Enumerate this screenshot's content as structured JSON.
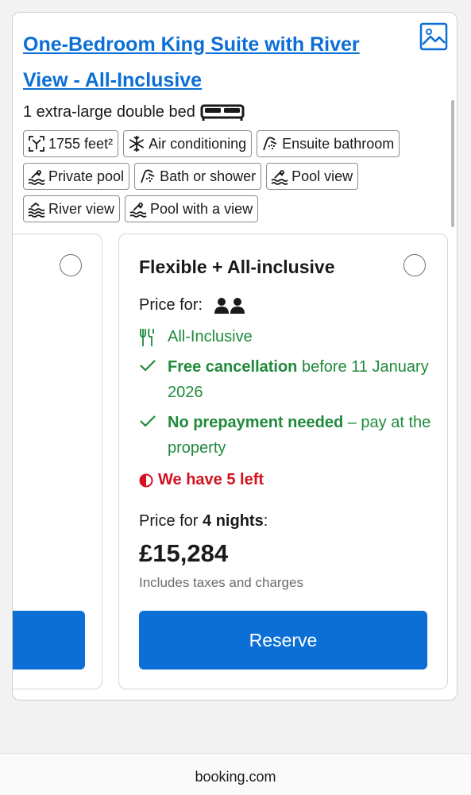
{
  "room": {
    "title": "One-Bedroom King Suite with River View - All-Inclusive",
    "bed": "1 extra-large double bed",
    "facilities": [
      {
        "label": "1755 feet²",
        "icon": "room-size-icon"
      },
      {
        "label": "Air conditioning",
        "icon": "snowflake-icon"
      },
      {
        "label": "Ensuite bathroom",
        "icon": "shower-icon"
      },
      {
        "label": "Private pool",
        "icon": "pool-icon"
      },
      {
        "label": "Bath or shower",
        "icon": "bath-icon"
      },
      {
        "label": "Pool view",
        "icon": "pool-icon"
      },
      {
        "label": "River view",
        "icon": "river-icon"
      },
      {
        "label": "Pool with a view",
        "icon": "pool-icon"
      }
    ]
  },
  "offer": {
    "title": "Flexible + All-inclusive",
    "price_for_label": "Price for:",
    "meal": "All-Inclusive",
    "cancellation_bold": "Free cancellation",
    "cancellation_rest": " before 11 January 2026",
    "prepayment_bold": "No prepayment needed",
    "prepayment_rest": " – pay at the property",
    "availability": "We have 5 left",
    "nights_prefix": "Price for ",
    "nights_bold": "4 nights",
    "nights_suffix": ":",
    "price": "£15,284",
    "taxes": "Includes taxes and charges",
    "reserve_label": "Reserve"
  },
  "footer": {
    "brand": "booking.com"
  },
  "colors": {
    "accent": "#0b6fd6",
    "positive": "#1f8a3b",
    "alert": "#d4111e"
  }
}
